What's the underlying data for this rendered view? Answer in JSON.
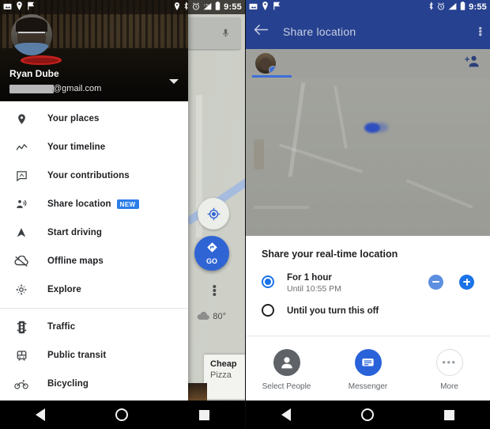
{
  "left_screen": {
    "statusbar": {
      "time": "9:55",
      "left_icons": [
        "image-icon",
        "location-pin-icon",
        "flag-icon"
      ],
      "right_icons": [
        "location-pin-icon",
        "bluetooth-icon",
        "alarm-icon",
        "signal-icon",
        "battery-icon"
      ]
    },
    "drawer": {
      "account_name": "Ryan Dube",
      "account_email_domain": "@gmail.com",
      "account_email_redacted": true,
      "expand_icon": "chevron-down-icon",
      "items": [
        {
          "label": "Your places",
          "icon": "place-pin-icon",
          "badge": null
        },
        {
          "label": "Your timeline",
          "icon": "timeline-icon",
          "badge": null
        },
        {
          "label": "Your contributions",
          "icon": "contributions-icon",
          "badge": null
        },
        {
          "label": "Share location",
          "icon": "share-location-icon",
          "badge": "NEW"
        },
        {
          "label": "Start driving",
          "icon": "navigation-arrow-icon",
          "badge": null
        },
        {
          "label": "Offline maps",
          "icon": "cloud-offline-icon",
          "badge": null
        },
        {
          "label": "Explore",
          "icon": "explore-compass-icon",
          "badge": null
        }
      ],
      "items_secondary": [
        {
          "label": "Traffic",
          "icon": "traffic-light-icon"
        },
        {
          "label": "Public transit",
          "icon": "train-icon"
        },
        {
          "label": "Bicycling",
          "icon": "bicycle-icon"
        }
      ],
      "badge_color": "#2b7de9"
    },
    "map": {
      "search_mic_icon": "microphone-icon",
      "my_location_icon": "my-location-icon",
      "go_button_label": "GO",
      "go_button_icon": "navigation-diamond-icon",
      "go_button_color": "#2f64d4",
      "overflow_icon": "more-vertical-icon",
      "weather_icon": "cloud-icon",
      "weather_temp": "80°",
      "card_title": "Cheap",
      "card_subtitle": "Pizza"
    },
    "navbar": {
      "back_icon": "back-triangle-icon",
      "home_icon": "home-circle-icon",
      "recents_icon": "recents-square-icon"
    }
  },
  "right_screen": {
    "statusbar": {
      "time": "9:55",
      "left_icons": [
        "image-icon",
        "location-pin-icon",
        "flag-icon"
      ],
      "right_icons": [
        "bluetooth-icon",
        "alarm-icon",
        "signal-icon",
        "battery-icon"
      ]
    },
    "toolbar": {
      "back_icon": "back-arrow-icon",
      "title": "Share location",
      "overflow_icon": "more-vertical-icon",
      "color": "#26418f"
    },
    "tabstrip": {
      "avatar_name": "avatar",
      "avatar_badge": "location-badge",
      "add_person_icon": "add-person-icon",
      "indicator_color": "#3f6fd8"
    },
    "map_preview": {
      "location_dot": "blue-location-dot"
    },
    "sheet": {
      "title": "Share your real-time location",
      "options": [
        {
          "label": "For 1 hour",
          "sublabel": "Until 10:55 PM",
          "selected": true,
          "decrement_icon": "minus-icon",
          "increment_icon": "plus-icon"
        },
        {
          "label": "Until you turn this off",
          "sublabel": null,
          "selected": false
        }
      ],
      "accent_color": "#1a73e8",
      "share_targets": [
        {
          "label": "Select People",
          "icon": "person-icon",
          "style": "grey"
        },
        {
          "label": "Messenger",
          "icon": "messenger-icon",
          "style": "blue"
        },
        {
          "label": "More",
          "icon": "more-horizontal-icon",
          "style": "outline"
        }
      ]
    },
    "navbar": {
      "back_icon": "back-triangle-icon",
      "home_icon": "home-circle-icon",
      "recents_icon": "recents-square-icon"
    }
  }
}
